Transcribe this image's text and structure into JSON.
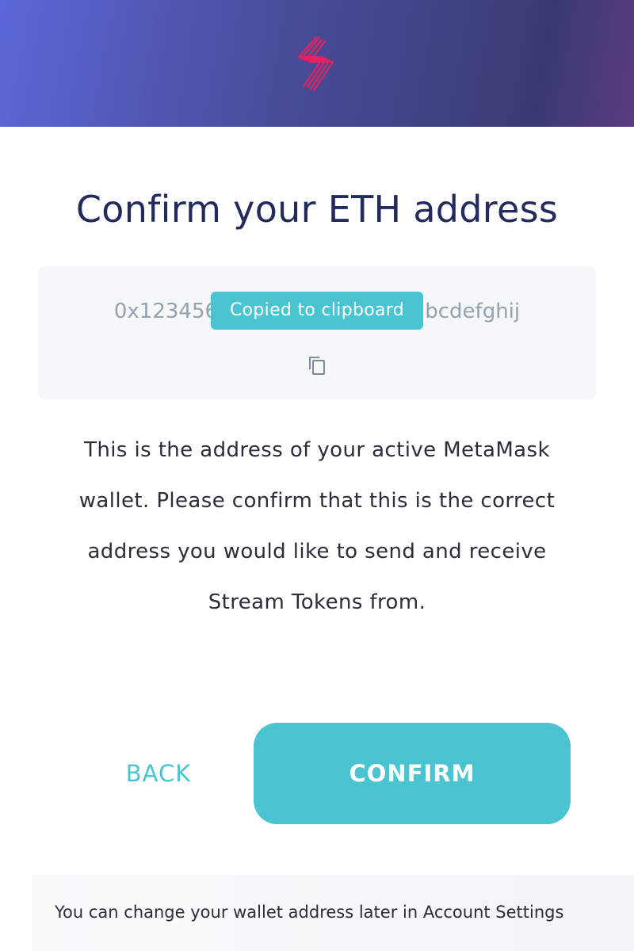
{
  "header": {
    "logo_icon": "stream-bolt-logo-icon",
    "logo_color": "#e0245e"
  },
  "main": {
    "title": "Confirm your ETH address",
    "address": {
      "value": "0x1234567890abcdefghij1234567890abcdefghij",
      "prefix_visible": "0x1234567890",
      "suffix_visible": "90abcdefghij",
      "tooltip": "Copied to clipboard",
      "copy_icon": "copy-icon"
    },
    "description": "This is the address of your active MetaMask wallet. Please confirm that this is the correct address you would like to send and receive Stream Tokens from."
  },
  "actions": {
    "back_label": "BACK",
    "confirm_label": "CONFIRM"
  },
  "footer": {
    "note": "You can change your wallet address later in Account Settings"
  },
  "colors": {
    "accent": "#4bc4d1",
    "title": "#232a5e",
    "header_gradient_start": "#5c67d8",
    "header_gradient_end": "#5a3a82"
  }
}
